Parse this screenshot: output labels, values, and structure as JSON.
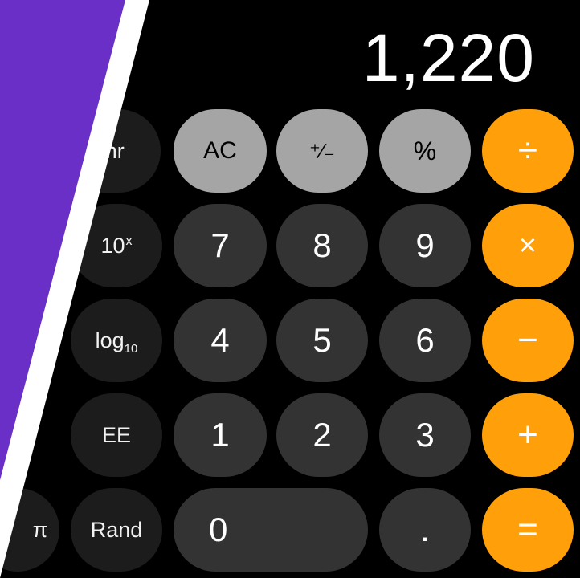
{
  "display": {
    "value": "1,220"
  },
  "colors": {
    "background": "#000000",
    "function_key": "#a5a5a5",
    "number_key": "#333333",
    "scientific_key": "#1c1c1c",
    "operator_key": "#ff9f0a",
    "overlay_purple": "#6a2fc6",
    "overlay_stripe": "#ffffff"
  },
  "keys": {
    "mr": "mr",
    "ac": "AC",
    "plus_minus": "⁺∕₋",
    "percent": "%",
    "divide": "÷",
    "ten_power_base": "10",
    "ten_power_sup": "x",
    "seven": "7",
    "eight": "8",
    "nine": "9",
    "multiply": "×",
    "log_base": "log",
    "log_sub": "10",
    "four": "4",
    "five": "5",
    "six": "6",
    "minus": "−",
    "ee": "EE",
    "one": "1",
    "two": "2",
    "three": "3",
    "plus": "+",
    "pi": "π",
    "rand": "Rand",
    "zero": "0",
    "decimal": ".",
    "equals": "="
  }
}
